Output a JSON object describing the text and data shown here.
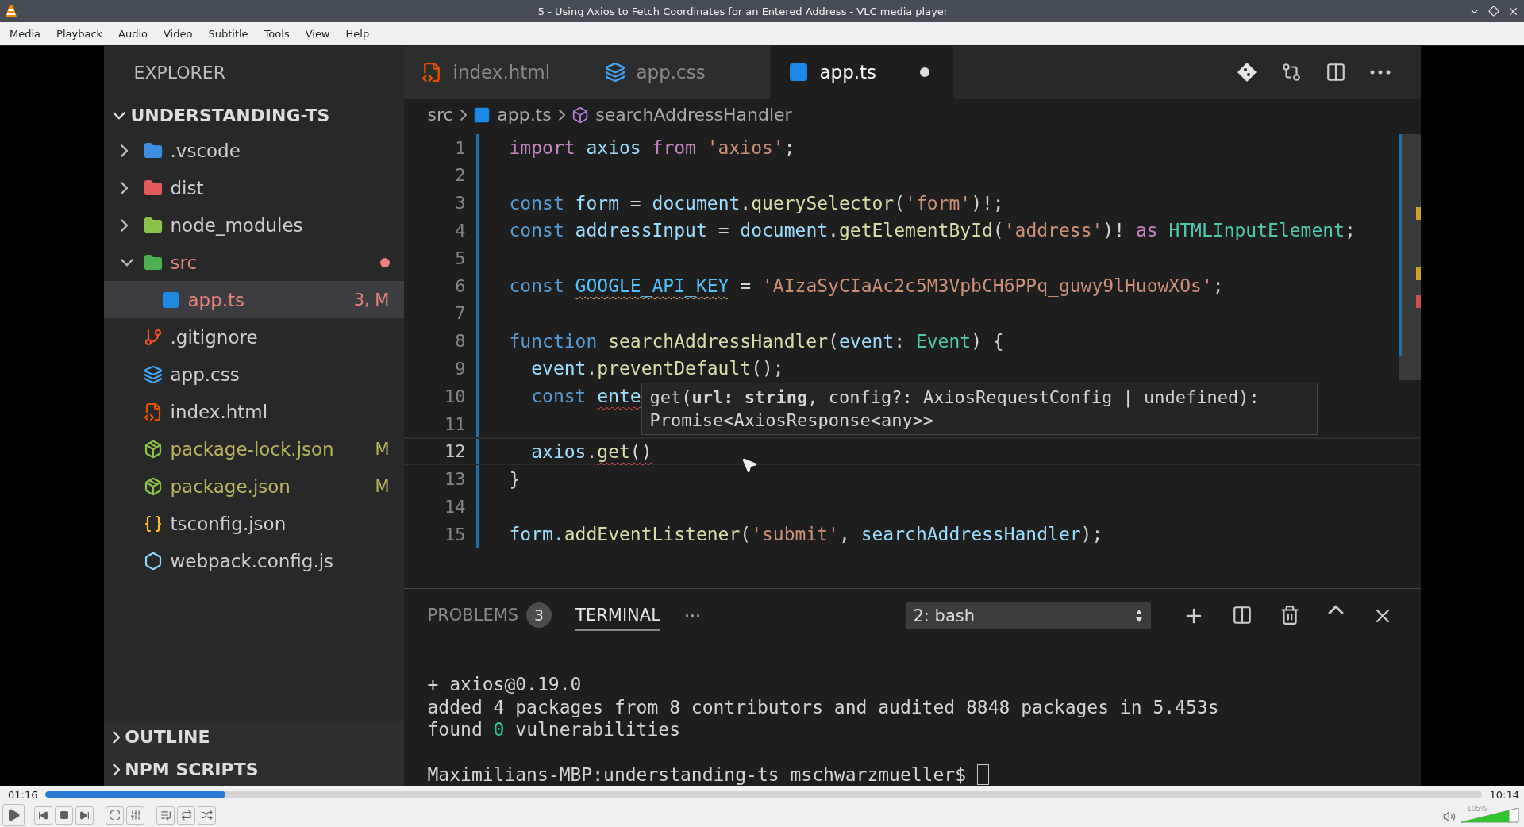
{
  "window": {
    "title": "5 - Using Axios to Fetch Coordinates for an Entered Address - VLC media player"
  },
  "menu": [
    "Media",
    "Playback",
    "Audio",
    "Video",
    "Subtitle",
    "Tools",
    "View",
    "Help"
  ],
  "video": {
    "explorer": {
      "title": "EXPLORER",
      "project": {
        "name": "UNDERSTANDING-TS",
        "expanded": true
      },
      "tree": [
        {
          "name": ".vscode",
          "kind": "folder-config",
          "expanded": false,
          "selected": false,
          "color": "#cfcfcf"
        },
        {
          "name": "dist",
          "kind": "folder-dist",
          "expanded": false,
          "selected": false,
          "color": "#cfcfcf"
        },
        {
          "name": "node_modules",
          "kind": "folder-node",
          "expanded": false,
          "selected": false,
          "color": "#cfcfcf"
        },
        {
          "name": "src",
          "kind": "folder-src",
          "expanded": true,
          "selected": false,
          "color": "#e8837c",
          "dot": true,
          "children": [
            {
              "name": "app.ts",
              "kind": "ts",
              "selected": true,
              "color": "#e8837c",
              "badge": "3, M"
            }
          ]
        },
        {
          "name": ".gitignore",
          "kind": "git",
          "selected": false,
          "color": "#cfcfcf"
        },
        {
          "name": "app.css",
          "kind": "css",
          "selected": false,
          "color": "#cfcfcf"
        },
        {
          "name": "index.html",
          "kind": "html",
          "selected": false,
          "color": "#cfcfcf"
        },
        {
          "name": "package-lock.json",
          "kind": "json",
          "selected": false,
          "color": "#b9b45e",
          "badge": "M"
        },
        {
          "name": "package.json",
          "kind": "json",
          "selected": false,
          "color": "#b9b45e",
          "badge": "M"
        },
        {
          "name": "tsconfig.json",
          "kind": "braces",
          "selected": false,
          "color": "#cfcfcf"
        },
        {
          "name": "webpack.config.js",
          "kind": "webpack",
          "selected": false,
          "color": "#cfcfcf"
        }
      ],
      "sections": [
        {
          "name": "OUTLINE",
          "expanded": false
        },
        {
          "name": "NPM SCRIPTS",
          "expanded": false
        }
      ]
    },
    "tabs": [
      {
        "label": "index.html",
        "kind": "html",
        "selected": false,
        "dirty": false
      },
      {
        "label": "app.css",
        "kind": "css",
        "selected": false,
        "dirty": false
      },
      {
        "label": "app.ts",
        "kind": "ts",
        "selected": true,
        "dirty": true
      }
    ],
    "breadcrumb": [
      "src",
      "app.ts",
      "searchAddressHandler"
    ],
    "code": [
      {
        "number": "1",
        "current": false,
        "tokens": [
          {
            "kind": "control",
            "text": "import"
          },
          {
            "kind": "var",
            "text": " axios "
          },
          {
            "kind": "control",
            "text": "from"
          },
          {
            "kind": "str",
            "text": " 'axios'"
          },
          {
            "kind": "plain",
            "text": ";"
          }
        ]
      },
      {
        "number": "2",
        "current": false
      },
      {
        "number": "3",
        "current": false,
        "tokens": [
          {
            "kind": "storage",
            "text": "const"
          },
          {
            "kind": "var",
            "text": " form "
          },
          {
            "kind": "plain",
            "text": "= "
          },
          {
            "kind": "var",
            "text": "document"
          },
          {
            "kind": "plain",
            "text": "."
          },
          {
            "kind": "func",
            "text": "querySelector"
          },
          {
            "kind": "plain",
            "text": "("
          },
          {
            "kind": "str",
            "text": "'form'"
          },
          {
            "kind": "plain",
            "text": ")!;"
          }
        ]
      },
      {
        "number": "4",
        "current": false,
        "tokens": [
          {
            "kind": "storage",
            "text": "const"
          },
          {
            "kind": "var",
            "text": " addressInput "
          },
          {
            "kind": "plain",
            "text": "= "
          },
          {
            "kind": "var",
            "text": "document"
          },
          {
            "kind": "plain",
            "text": "."
          },
          {
            "kind": "func",
            "text": "getElementById"
          },
          {
            "kind": "plain",
            "text": "("
          },
          {
            "kind": "str",
            "text": "'address'"
          },
          {
            "kind": "plain",
            "text": ")! "
          },
          {
            "kind": "control",
            "text": "as"
          },
          {
            "kind": "type",
            "text": " HTMLInputElement"
          },
          {
            "kind": "plain",
            "text": ";"
          }
        ]
      },
      {
        "number": "5",
        "current": false
      },
      {
        "number": "6",
        "current": false,
        "tokens": [
          {
            "kind": "storage",
            "text": "const "
          },
          {
            "kind": "const",
            "text": "GOOGLE_API_KEY",
            "warning": true
          },
          {
            "kind": "plain",
            "text": " = "
          },
          {
            "kind": "str",
            "text": "'AIzaSyCIaAc2c5M3VpbCH6PPq_guwy9lHuowXOs'"
          },
          {
            "kind": "plain",
            "text": ";"
          }
        ]
      },
      {
        "number": "7",
        "current": false
      },
      {
        "number": "8",
        "current": false,
        "tokens": [
          {
            "kind": "storage",
            "text": "function "
          },
          {
            "kind": "func",
            "text": "searchAddressHandler"
          },
          {
            "kind": "plain",
            "text": "("
          },
          {
            "kind": "var",
            "text": "event"
          },
          {
            "kind": "plain",
            "text": ": "
          },
          {
            "kind": "type",
            "text": "Event"
          },
          {
            "kind": "plain",
            "text": ") {"
          }
        ]
      },
      {
        "number": "9",
        "current": false,
        "tokens": [
          {
            "kind": "var",
            "text": "  event"
          },
          {
            "kind": "plain",
            "text": "."
          },
          {
            "kind": "func",
            "text": "preventDefault"
          },
          {
            "kind": "plain",
            "text": "();"
          }
        ]
      },
      {
        "number": "10",
        "current": false,
        "tokens": [
          {
            "kind": "storage",
            "text": "  const "
          },
          {
            "kind": "var",
            "text": "ente",
            "error": true
          }
        ]
      },
      {
        "number": "11",
        "current": false
      },
      {
        "number": "12",
        "current": true,
        "tokens": [
          {
            "kind": "var",
            "text": "  axios"
          },
          {
            "kind": "plain",
            "text": "."
          },
          {
            "kind": "func",
            "text": "get",
            "error": true
          },
          {
            "kind": "plain",
            "text": "()",
            "error": true
          }
        ]
      },
      {
        "number": "13",
        "current": false,
        "tokens": [
          {
            "kind": "plain",
            "text": "}"
          }
        ]
      },
      {
        "number": "14",
        "current": false
      },
      {
        "number": "15",
        "current": false,
        "tokens": [
          {
            "kind": "var",
            "text": "form."
          },
          {
            "kind": "func",
            "text": "addEventListener"
          },
          {
            "kind": "plain",
            "text": "("
          },
          {
            "kind": "str",
            "text": "'submit'"
          },
          {
            "kind": "plain",
            "text": ", "
          },
          {
            "kind": "var",
            "text": "searchAddressHandler"
          },
          {
            "kind": "plain",
            "text": ");"
          }
        ]
      }
    ],
    "tooltip": [
      "get(**url: string**, config?: AxiosRequestConfig | undefined):",
      "Promise<AxiosResponse<any>>"
    ],
    "panel": {
      "tabs": [
        {
          "label": "PROBLEMS",
          "badge": "3",
          "selected": false
        },
        {
          "label": "TERMINAL",
          "selected": true
        }
      ],
      "more": "···",
      "terminal_select": "2: bash",
      "terminal": [
        {
          "tokens": [
            {
              "kind": "plain",
              "text": "+ axios@0.19.0"
            }
          ]
        },
        {
          "tokens": [
            {
              "kind": "plain",
              "text": "added 4 packages from 8 contributors and audited 8848 packages in 5.453s"
            }
          ]
        },
        {
          "tokens": [
            {
              "kind": "plain",
              "text": "found "
            },
            {
              "kind": "ok",
              "text": "0"
            },
            {
              "kind": "plain",
              "text": " vulnerabilities"
            }
          ]
        },
        {
          "prompt": true,
          "tokens": [
            {
              "kind": "plain",
              "text": "Maximilians-MBP:understanding-ts mschwarzmueller$"
            }
          ]
        }
      ]
    }
  },
  "player": {
    "elapsed": "01:16",
    "total": "10:14",
    "level": 0.125,
    "volume": {
      "reading": "105%",
      "level": 0.84
    }
  }
}
